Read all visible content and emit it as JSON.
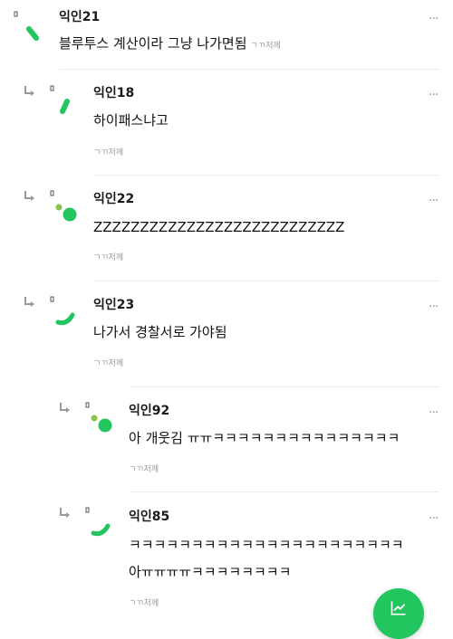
{
  "comments": [
    {
      "author": "익인21",
      "text": "블루투스 계산이라 그냥 나가면됨",
      "meta": "ㄱㄲ저께",
      "more": "···",
      "is_reply": false
    },
    {
      "author": "익인18",
      "text": "하이패스냐고",
      "meta": "ㄱㄲ저께",
      "more": "···",
      "is_reply": true
    },
    {
      "author": "익인22",
      "text": "ZZZZZZZZZZZZZZZZZZZZZZZZZZZ",
      "meta": "ㄱㄲ저께",
      "more": "···",
      "is_reply": true
    },
    {
      "author": "익인23",
      "text": "나가서 경찰서로 가야됨",
      "meta": "ㄱㄲ저께",
      "more": "···",
      "is_reply": true
    },
    {
      "author": "익인92",
      "text": "아 개웃김 ㅠㅠㅋㅋㅋㅋㅋㅋㅋㅋㅋㅋㅋㅋㅋㅋㅋ",
      "meta": "ㄱㄲ저께",
      "more": "···",
      "is_reply": true
    },
    {
      "author": "익인85",
      "text_line1": "ㅋㅋㅋㅋㅋㅋㅋㅋㅋㅋㅋㅋㅋㅋㅋㅋㅋㅋㅋㅋㅋㅋ",
      "text_line2": "아ㅠㅠㅠㅠㅋㅋㅋㅋㅋㅋㅋㅋ",
      "meta": "ㄱㄲ저께",
      "more": "···",
      "is_reply": true
    }
  ],
  "colors": {
    "accent": "#22c55e",
    "accent_light": "#8bc34a",
    "separator": "#ececec",
    "meta": "#9a9a9a"
  },
  "icons": [
    "reply-arrow-icon",
    "avatar-stroke-icon",
    "more-icon",
    "chart-icon"
  ]
}
